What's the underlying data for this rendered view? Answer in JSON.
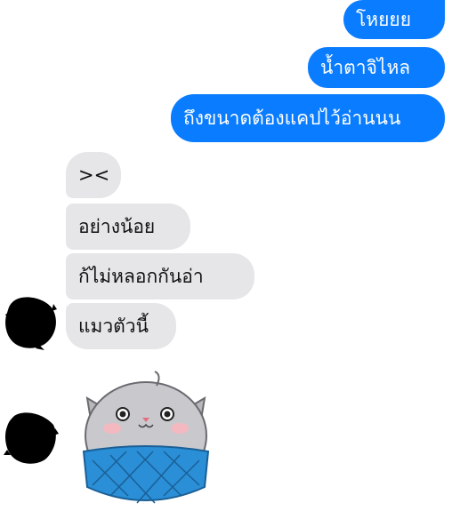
{
  "messages_out": [
    {
      "text": "โหยยย"
    },
    {
      "text": "น้ำตาจิไหล"
    },
    {
      "text": "ถึงขนาดต้องแคปไว้อ่านนน"
    }
  ],
  "messages_in": [
    {
      "text": "><"
    },
    {
      "text": "อย่างน้อย"
    },
    {
      "text": "ก้ไม่หลอกกันอ่า"
    },
    {
      "text": "แมวตัวนี้"
    }
  ],
  "sticker": {
    "icon": "cat-ball-sticker-icon"
  },
  "colors": {
    "outgoing_bubble": "#0a7cff",
    "incoming_bubble": "#e6e6e8",
    "background": "#ffffff"
  }
}
